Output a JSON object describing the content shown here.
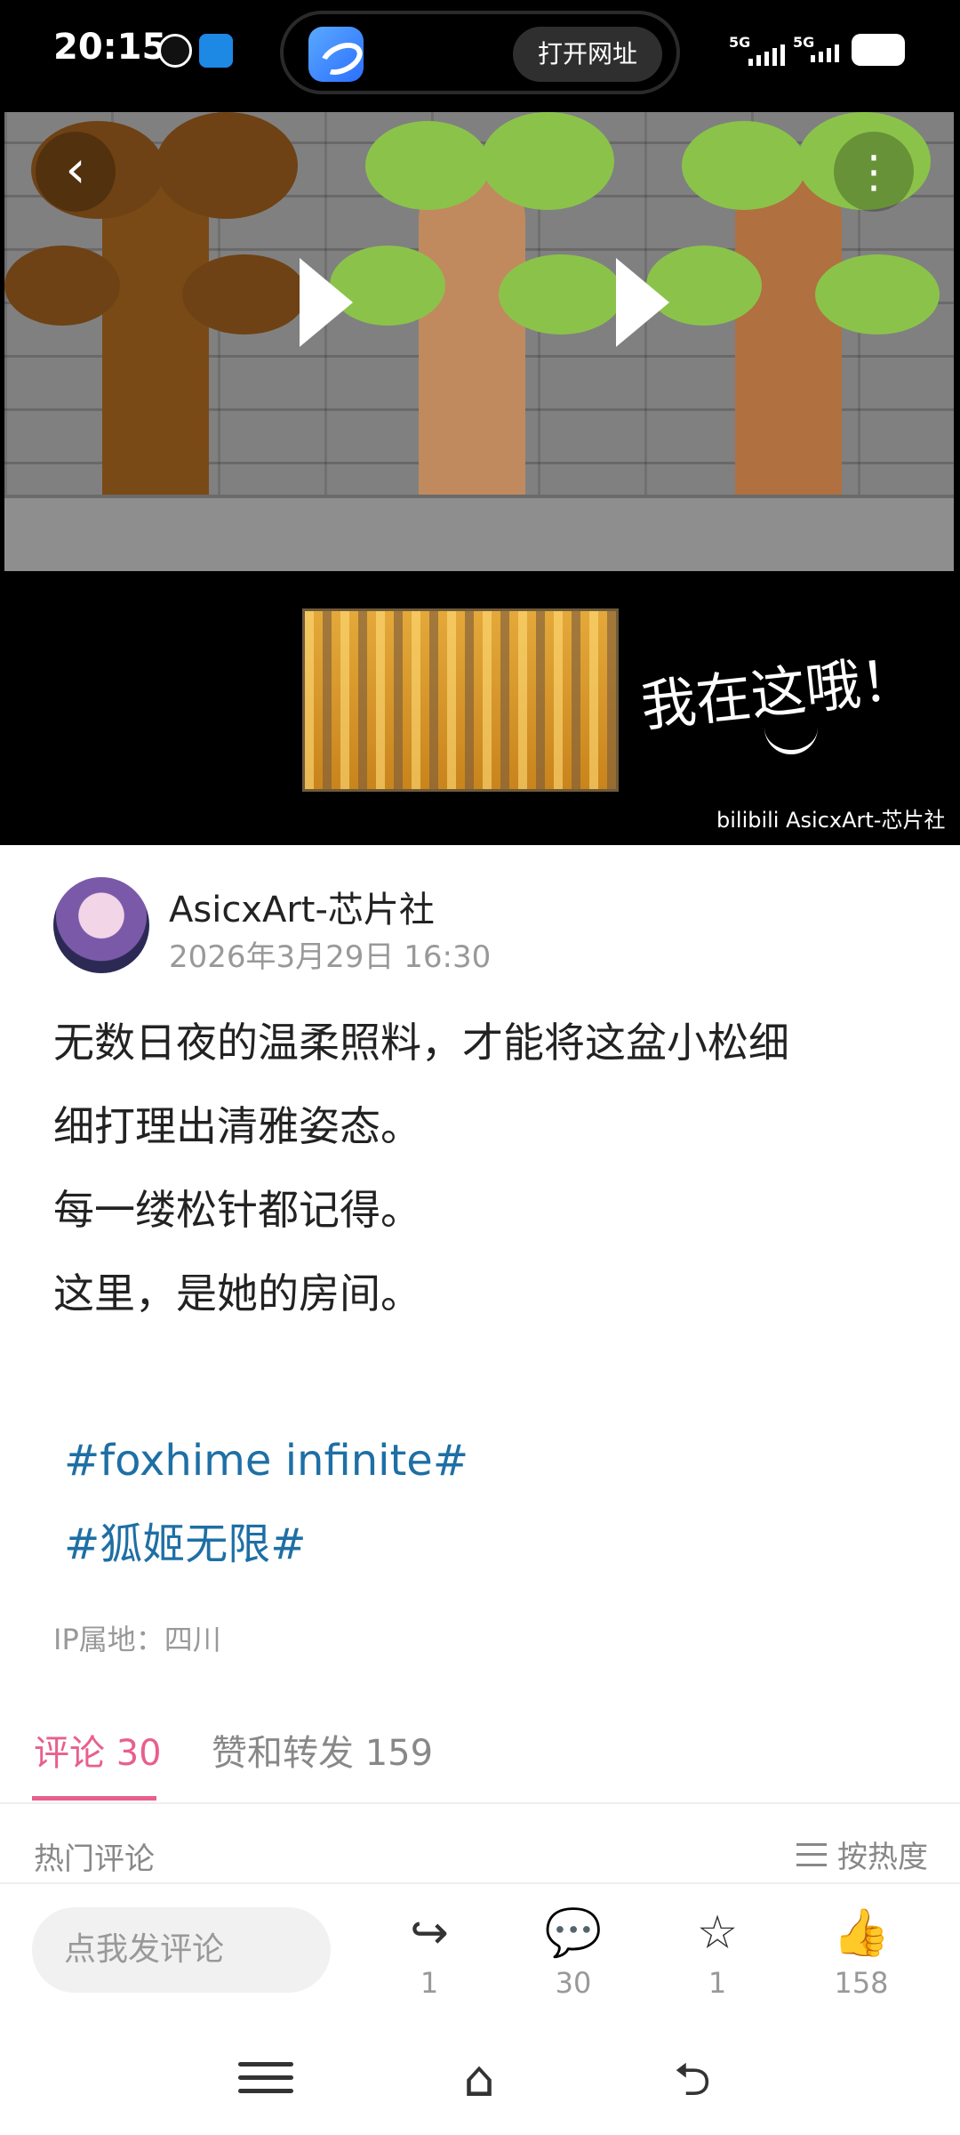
{
  "status_bar": {
    "time": "20:15",
    "url_open_label": "打开网址",
    "signal_1": "5G",
    "signal_2": "5G"
  },
  "hero": {
    "overlay_text": "我在这哦！",
    "watermark": "bilibili AsicxArt-芯片社"
  },
  "post": {
    "author": "AsicxArt-芯片社",
    "date": "2026年3月29日 16:30",
    "lines": [
      "无数日夜的温柔照料，才能将这盆小松细",
      "细打理出清雅姿态。",
      "每一缕松针都记得。",
      "这里，是她的房间。"
    ],
    "tags": [
      "#foxhime infinite#",
      "#狐姬无限#"
    ],
    "ip_location": "IP属地：四川"
  },
  "tabs": {
    "comments": "评论 30",
    "likes_shares": "赞和转发 159"
  },
  "comments": {
    "hot_title": "热门评论",
    "sort_label": "按热度"
  },
  "bottom_bar": {
    "input_placeholder": "点我发评论",
    "share_count": "1",
    "comment_count": "30",
    "favorite_count": "1",
    "like_count": "158"
  },
  "colors": {
    "accent": "#e85f8e",
    "tag": "#1e6fa5"
  }
}
